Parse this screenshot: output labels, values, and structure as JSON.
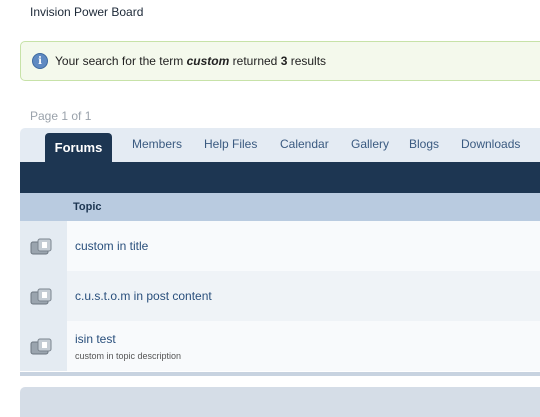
{
  "header": {
    "brand": "Invision Power Board"
  },
  "search_notice": {
    "prefix": "Your search for the term ",
    "term": "custom",
    "middle": " returned ",
    "count": "3",
    "suffix": " results"
  },
  "pagination": {
    "label": "Page 1 of 1"
  },
  "tabs": [
    {
      "label": "Forums",
      "active": true
    },
    {
      "label": "Members"
    },
    {
      "label": "Help Files"
    },
    {
      "label": "Calendar"
    },
    {
      "label": "Gallery"
    },
    {
      "label": "Blogs"
    },
    {
      "label": "Downloads"
    }
  ],
  "table": {
    "column_topic": "Topic",
    "rows": [
      {
        "title": "custom in title",
        "description": ""
      },
      {
        "title": "c.u.s.t.o.m in post content",
        "description": ""
      },
      {
        "title": "isin test",
        "description": "custom in topic description"
      }
    ]
  },
  "icons": {
    "info": "info-icon",
    "topic": "topic-read-icon"
  },
  "colors": {
    "nav_dark": "#1d3652",
    "notice_bg": "#f4f9ec",
    "notice_border": "#c7e2a8",
    "link": "#294f7c"
  }
}
